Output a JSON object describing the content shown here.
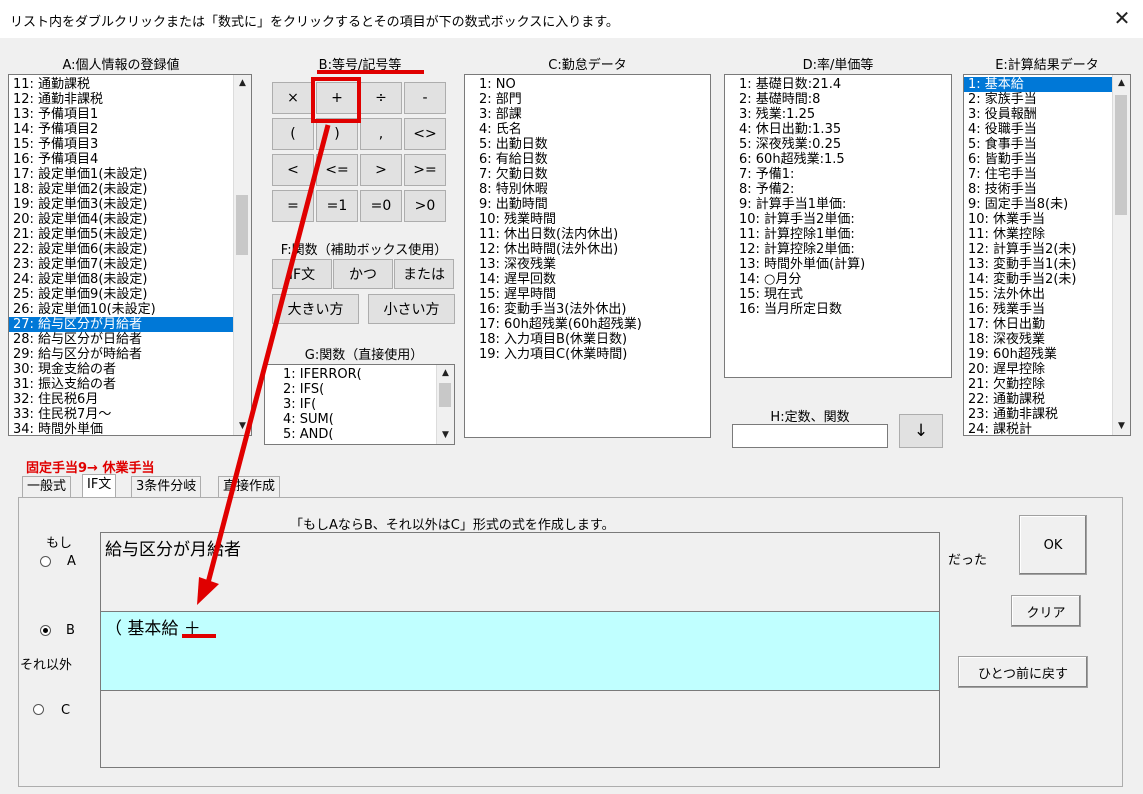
{
  "window": {
    "title": "リスト内をダブルクリックまたは「数式に」をクリックするとその項目が下の数式ボックスに入ります。",
    "close": "✕"
  },
  "panelA": {
    "header": "A:個人情報の登録値",
    "items": [
      "11: 通勤課税",
      "12: 通勤非課税",
      "13: 予備項目1",
      "14: 予備項目2",
      "15: 予備項目3",
      "16: 予備項目4",
      "17: 設定単価1(未設定)",
      "18: 設定単価2(未設定)",
      "19: 設定単価3(未設定)",
      "20: 設定単価4(未設定)",
      "21: 設定単価5(未設定)",
      "22: 設定単価6(未設定)",
      "23: 設定単価7(未設定)",
      "24: 設定単価8(未設定)",
      "25: 設定単価9(未設定)",
      "26: 設定単価10(未設定)",
      "27: 給与区分が月給者",
      "28: 給与区分が日給者",
      "29: 給与区分が時給者",
      "30: 現金支給の者",
      "31: 振込支給の者",
      "32: 住民税6月",
      "33: 住民税7月～",
      "34: 時間外単価"
    ],
    "selected": 16
  },
  "panelB": {
    "header": "B:等号/記号等",
    "buttons": [
      "×",
      "+",
      "÷",
      "-",
      "(",
      ")",
      ",",
      "<>",
      "<",
      "<=",
      ">",
      ">=",
      "=",
      "=1",
      "=0",
      ">0"
    ]
  },
  "panelF": {
    "header": "F:関数（補助ボックス使用）",
    "buttons": [
      "IF文",
      "かつ",
      "または",
      "大きい方",
      "小さい方"
    ]
  },
  "panelG": {
    "header": "G:関数（直接使用）",
    "items": [
      "1: IFERROR(",
      "2: IFS(",
      "3: IF(",
      "4: SUM(",
      "5: AND("
    ]
  },
  "panelC": {
    "header": "C:勤怠データ",
    "items": [
      "1: NO",
      "2: 部門",
      "3: 部課",
      "4: 氏名",
      "5: 出勤日数",
      "6: 有給日数",
      "7: 欠勤日数",
      "8: 特別休暇",
      "9: 出勤時間",
      "10: 残業時間",
      "11: 休出日数(法内休出)",
      "12: 休出時間(法外休出)",
      "13: 深夜残業",
      "14: 遅早回数",
      "15: 遅早時間",
      "16: 変動手当3(法外休出)",
      "17: 60h超残業(60h超残業)",
      "18: 入力項目B(休業日数)",
      "19: 入力項目C(休業時間)"
    ]
  },
  "panelD": {
    "header": "D:率/単価等",
    "items": [
      "1: 基礎日数:21.4",
      "2: 基礎時間:8",
      "3: 残業:1.25",
      "4: 休日出勤:1.35",
      "5: 深夜残業:0.25",
      "6: 60h超残業:1.5",
      "7: 予備1:",
      "8: 予備2:",
      "9: 計算手当1単価:",
      "10: 計算手当2単価:",
      "11: 計算控除1単価:",
      "12: 計算控除2単価:",
      "13: 時間外単価(計算)",
      "14: ○月分",
      "15: 現在式",
      "16: 当月所定日数"
    ]
  },
  "panelH": {
    "header": "H:定数、関数",
    "input_value": "",
    "down_button": "↓"
  },
  "panelE": {
    "header": "E:計算結果データ",
    "items": [
      "1: 基本給",
      "2: 家族手当",
      "3: 役員報酬",
      "4: 役職手当",
      "5: 食事手当",
      "6: 皆勤手当",
      "7: 住宅手当",
      "8: 技術手当",
      "9: 固定手当8(未)",
      "10: 休業手当",
      "11: 休業控除",
      "12: 計算手当2(未)",
      "13: 変動手当1(未)",
      "14: 変動手当2(未)",
      "15: 法外休出",
      "16: 残業手当",
      "17: 休日出勤",
      "18: 深夜残業",
      "19: 60h超残業",
      "20: 遅早控除",
      "21: 欠勤控除",
      "22: 通勤課税",
      "23: 通勤非課税",
      "24: 課税計"
    ],
    "selected": 0
  },
  "status": {
    "target": "固定手当9→ 休業手当"
  },
  "tabs": [
    "一般式",
    "IF文",
    "3条件分岐",
    "直接作成"
  ],
  "active_tab": 1,
  "ifpanel": {
    "description": "「もしAならB、それ以外はC」形式の式を作成します。",
    "moshi": "もし",
    "radio_a": "A",
    "radio_b": "B",
    "radio_c": "C",
    "soreigai": "それ以外",
    "datta": "だった",
    "field_a": "給与区分が月給者",
    "field_b": "（ 基本給 ＋",
    "field_c": "",
    "ok": "OK",
    "clear": "クリア",
    "undo": "ひとつ前に戻す"
  },
  "colors": {
    "selection": "#0078d7",
    "field_b_bg": "#c0ffff",
    "annotation_red": "#e00000"
  }
}
